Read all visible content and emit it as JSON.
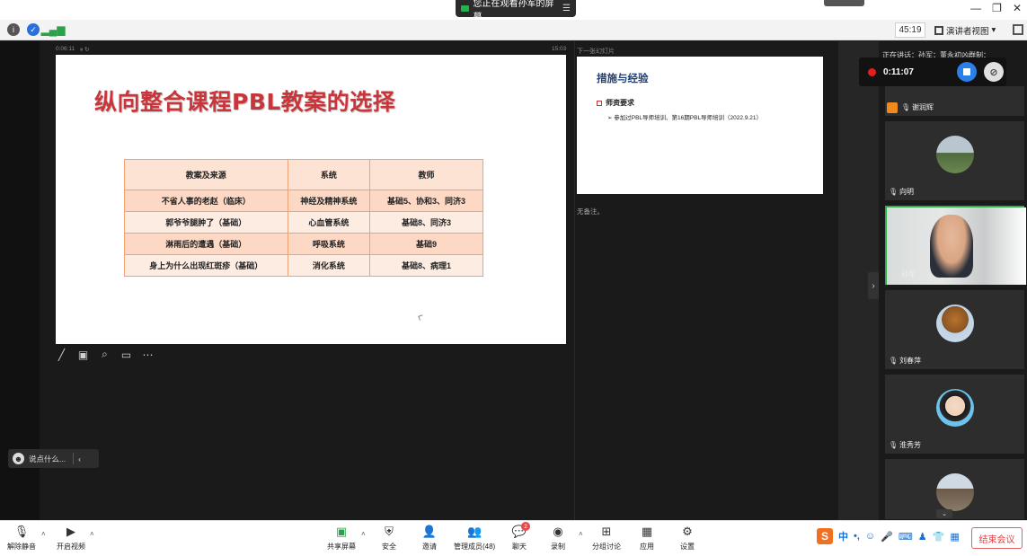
{
  "titlebar": {
    "share_notice": "您正在观看孙军的屏幕",
    "menu_icon": "list-icon",
    "minimize": "—",
    "restore": "❐",
    "close": "✕"
  },
  "infobar": {
    "timer": "45:19",
    "view_label": "演讲者视图",
    "view_caret": "▾"
  },
  "presenter": {
    "elapsed": "0:06:11",
    "pause_glyph": "⏸ ↻",
    "clock": "15:03",
    "next_slide_label": "下一张幻灯片",
    "notes": "无备注。"
  },
  "slide": {
    "title": "纵向整合课程PBL教案的选择",
    "table": {
      "headers": [
        "教案及来源",
        "系统",
        "教师"
      ],
      "rows": [
        [
          "不省人事的老赵（临床）",
          "神经及精神系统",
          "基础5、协和3、同济3"
        ],
        [
          "郭爷爷腿肿了（基础）",
          "心血管系统",
          "基础8、同济3"
        ],
        [
          "淋雨后的遭遇（基础）",
          "呼吸系统",
          "基础9"
        ],
        [
          "身上为什么出现红斑疹（基础）",
          "消化系统",
          "基础8、病理1"
        ]
      ]
    }
  },
  "next_slide": {
    "title": "措施与经验",
    "bullet": "师资要求",
    "sub": "➢ 参加过PBL导师培训、第16期PBL导师培训（2022.9.21）"
  },
  "tools": [
    "pen-icon",
    "eraser-icon",
    "zoom-icon",
    "screen-icon",
    "more-icon"
  ],
  "recording": {
    "time": "0:11:07",
    "speaking": "正在讲话：孙军；董永初凶群制："
  },
  "participants": [
    {
      "name": "谢润辉",
      "type": "partial"
    },
    {
      "name": "向明",
      "type": "avatar"
    },
    {
      "name": "孙军",
      "type": "video"
    },
    {
      "name": "刘春萍",
      "type": "avatar"
    },
    {
      "name": "淮秀芳",
      "type": "avatar"
    },
    {
      "name": "",
      "type": "avatar"
    }
  ],
  "chat": {
    "placeholder": "说点什么..."
  },
  "toolbar": {
    "unmute": "解除静音",
    "start_video": "开启视频",
    "share_screen": "共享屏幕",
    "security": "安全",
    "invite": "邀请",
    "manage_members": "管理成员(48)",
    "chat": "聊天",
    "chat_badge": "2",
    "record": "录制",
    "breakout": "分组讨论",
    "apps": "应用",
    "settings": "设置",
    "end_meeting": "结束会议"
  },
  "ime": {
    "logo": "S",
    "lang": "中",
    "punct": "•,",
    "icons": [
      "smile-icon",
      "mic-icon",
      "keyboard-icon",
      "person-icon",
      "shirt-icon",
      "grid-icon"
    ]
  },
  "colors": {
    "slide_title": "#c8353a",
    "table_border": "#f0a272",
    "record_red": "#e02020",
    "stop_blue": "#2a7fe8",
    "active_speaker": "#2bb24b"
  }
}
